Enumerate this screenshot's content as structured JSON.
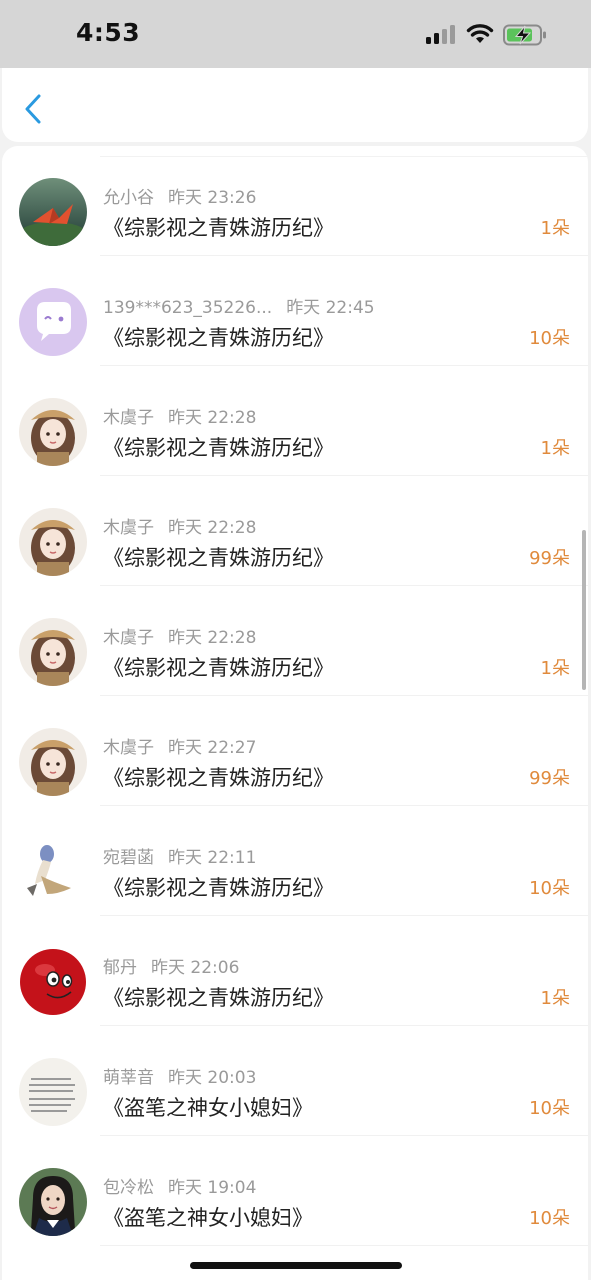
{
  "status_bar": {
    "time": "4:53"
  },
  "gifts": [
    {
      "name": "允小谷",
      "time": "昨天 23:26",
      "title": "《综影视之青姝游历纪》",
      "count": "1朵",
      "avatar": "paper-crane"
    },
    {
      "name": "139***623_35226...",
      "time": "昨天 22:45",
      "title": "《综影视之青姝游历纪》",
      "count": "10朵",
      "avatar": "default-chat"
    },
    {
      "name": "木虞子",
      "time": "昨天 22:28",
      "title": "《综影视之青姝游历纪》",
      "count": "1朵",
      "avatar": "anime-girl"
    },
    {
      "name": "木虞子",
      "time": "昨天 22:28",
      "title": "《综影视之青姝游历纪》",
      "count": "99朵",
      "avatar": "anime-girl"
    },
    {
      "name": "木虞子",
      "time": "昨天 22:28",
      "title": "《综影视之青姝游历纪》",
      "count": "1朵",
      "avatar": "anime-girl"
    },
    {
      "name": "木虞子",
      "time": "昨天 22:27",
      "title": "《综影视之青姝游历纪》",
      "count": "99朵",
      "avatar": "anime-girl"
    },
    {
      "name": "宛碧菡",
      "time": "昨天 22:11",
      "title": "《综影视之青姝游历纪》",
      "count": "10朵",
      "avatar": "creature"
    },
    {
      "name": "郁丹",
      "time": "昨天 22:06",
      "title": "《综影视之青姝游历纪》",
      "count": "1朵",
      "avatar": "red-ball"
    },
    {
      "name": "萌莘音",
      "time": "昨天 20:03",
      "title": "《盗笔之神女小媳妇》",
      "count": "10朵",
      "avatar": "text-note"
    },
    {
      "name": "包冷松",
      "time": "昨天 19:04",
      "title": "《盗笔之神女小媳妇》",
      "count": "10朵",
      "avatar": "portrait"
    }
  ]
}
